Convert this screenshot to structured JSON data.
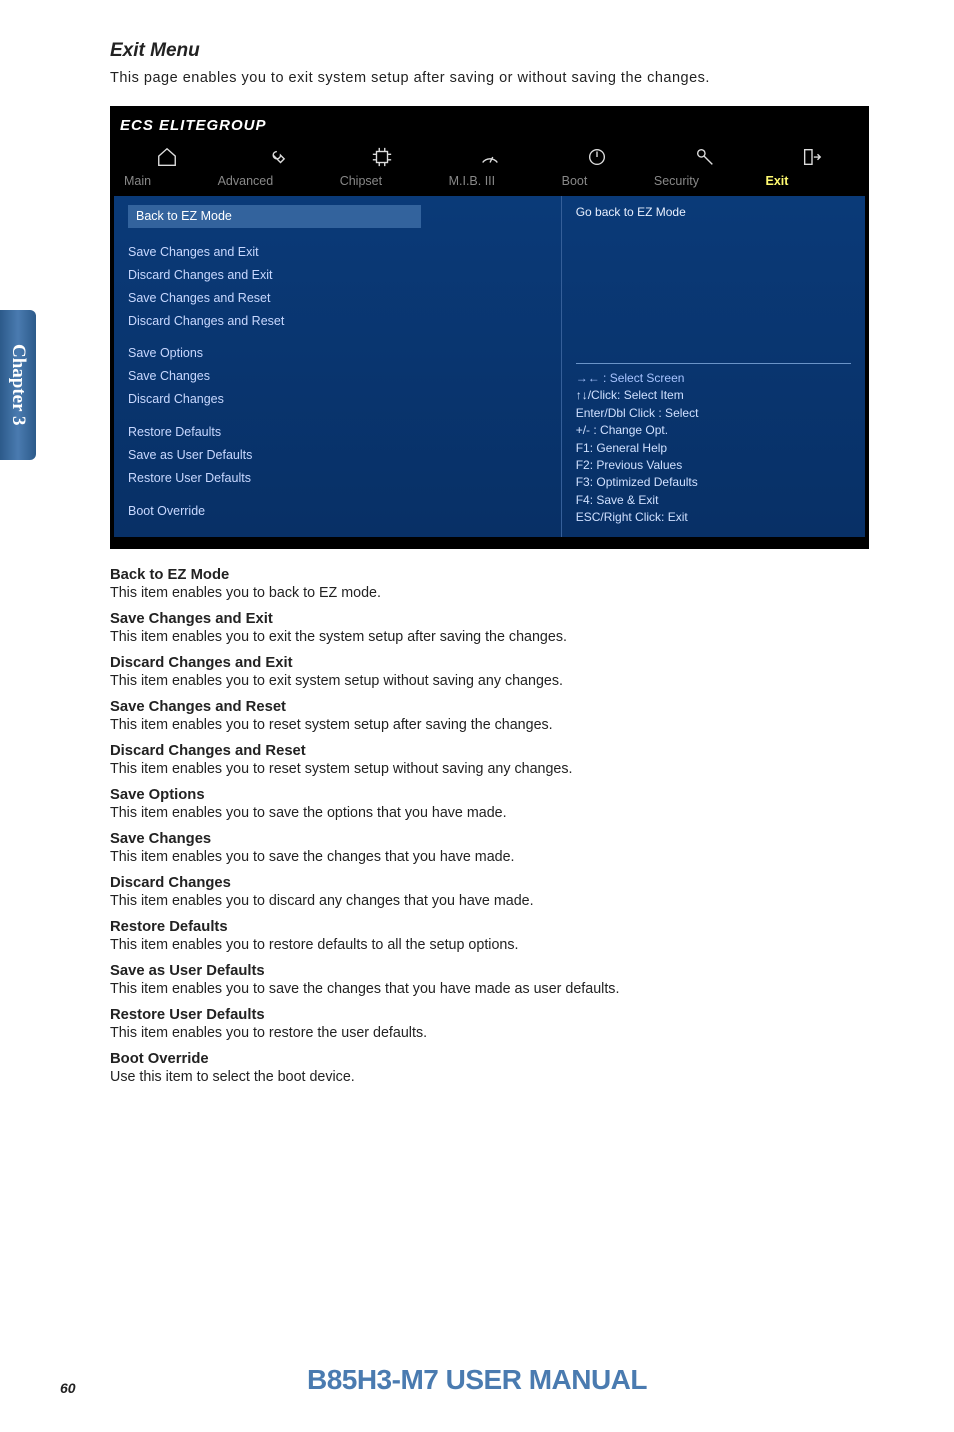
{
  "sidebar": {
    "label": "Chapter 3"
  },
  "exit": {
    "title": "Exit Menu",
    "intro": "This page enables you to exit system setup after saving or without saving the changes."
  },
  "bios": {
    "brand": "ELITEGROUP",
    "brand_prefix": "ECS",
    "tabs": {
      "main": "Main",
      "advanced": "Advanced",
      "chipset": "Chipset",
      "mib": "M.I.B. III",
      "boot": "Boot",
      "security": "Security",
      "exit": "Exit"
    },
    "menu": {
      "back": "Back to EZ Mode",
      "g1": [
        "Save Changes and Exit",
        "Discard Changes and Exit",
        "Save Changes and Reset",
        "Discard Changes and Reset"
      ],
      "g2_title": "Save Options",
      "g2": [
        "Save Changes",
        "Discard Changes"
      ],
      "g3": [
        "Restore Defaults",
        "Save as User Defaults",
        "Restore User Defaults"
      ],
      "g4": [
        "Boot Override"
      ]
    },
    "help": {
      "top": "Go back to EZ Mode",
      "k1": "→←   : Select Screen",
      "k2": "↑↓/Click: Select Item",
      "k3": "Enter/Dbl Click : Select",
      "k4": "+/- : Change Opt.",
      "k5": "F1: General Help",
      "k6": "F2: Previous Values",
      "k7": "F3: Optimized Defaults",
      "k8": "F4: Save & Exit",
      "k9": "ESC/Right Click: Exit"
    }
  },
  "items": {
    "back_ez": {
      "h": "Back to EZ Mode",
      "p": "This item enables you to back to EZ mode."
    },
    "save_exit": {
      "h": "Save Changes and Exit",
      "p": "This item enables you to exit  the system setup after saving the changes."
    },
    "discard_exit": {
      "h": "Discard Changes and Exit",
      "p": "This item enables you to exit system setup without saving any changes."
    },
    "save_reset": {
      "h": "Save Changes and Reset",
      "p": "This item enables you to reset system setup after saving the changes."
    },
    "discard_reset": {
      "h": "Discard Changes and Reset",
      "p": "This item enables you to reset system setup without saving any changes."
    },
    "save_opts": {
      "h": "Save Options",
      "p": "This item enables you to save the options that you have made."
    },
    "save_changes": {
      "h": "Save Changes",
      "p": "This item enables you to save the changes that you have made."
    },
    "discard_changes": {
      "h": "Discard Changes",
      "p": "This item enables you to discard any changes that you have made."
    },
    "restore_def": {
      "h": "Restore Defaults",
      "p": "This item enables you to restore defaults to all the setup options."
    },
    "save_user": {
      "h": "Save as User Defaults",
      "p": "This item enables you to save the changes that you have made as user defaults."
    },
    "restore_user": {
      "h": "Restore User Defaults",
      "p": "This item enables you to restore the user defaults."
    },
    "boot_override": {
      "h": "Boot Override",
      "p": "Use this item to select the boot device."
    }
  },
  "footer": {
    "title": "B85H3-M7 USER MANUAL",
    "page": "60"
  }
}
